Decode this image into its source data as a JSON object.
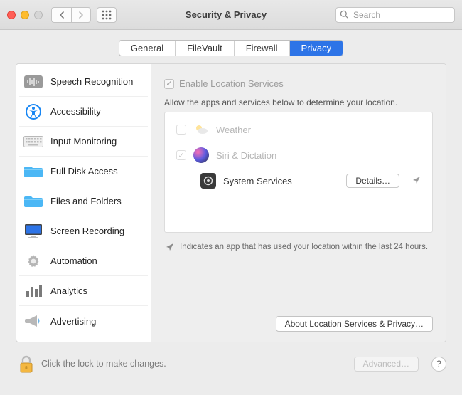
{
  "window": {
    "title": "Security & Privacy",
    "search_placeholder": "Search"
  },
  "tabs": {
    "general": "General",
    "filevault": "FileVault",
    "firewall": "Firewall",
    "privacy": "Privacy"
  },
  "sidebar": {
    "items": [
      {
        "label": "Speech Recognition",
        "icon": "waveform"
      },
      {
        "label": "Accessibility",
        "icon": "accessibility"
      },
      {
        "label": "Input Monitoring",
        "icon": "keyboard"
      },
      {
        "label": "Full Disk Access",
        "icon": "folder"
      },
      {
        "label": "Files and Folders",
        "icon": "folder"
      },
      {
        "label": "Screen Recording",
        "icon": "monitor"
      },
      {
        "label": "Automation",
        "icon": "gear"
      },
      {
        "label": "Analytics",
        "icon": "bars"
      },
      {
        "label": "Advertising",
        "icon": "megaphone"
      }
    ]
  },
  "content": {
    "enable_label": "Enable Location Services",
    "description": "Allow the apps and services below to determine your location.",
    "apps": [
      {
        "label": "Weather",
        "checked": false,
        "icon": "weather"
      },
      {
        "label": "Siri & Dictation",
        "checked": true,
        "icon": "siri"
      },
      {
        "label": "System Services",
        "indent": true,
        "icon": "gear-dark"
      }
    ],
    "details_button": "Details…",
    "note": "Indicates an app that has used your location within the last 24 hours.",
    "about_button": "About Location Services & Privacy…"
  },
  "footer": {
    "lock_text": "Click the lock to make changes.",
    "advanced": "Advanced…",
    "help": "?"
  }
}
